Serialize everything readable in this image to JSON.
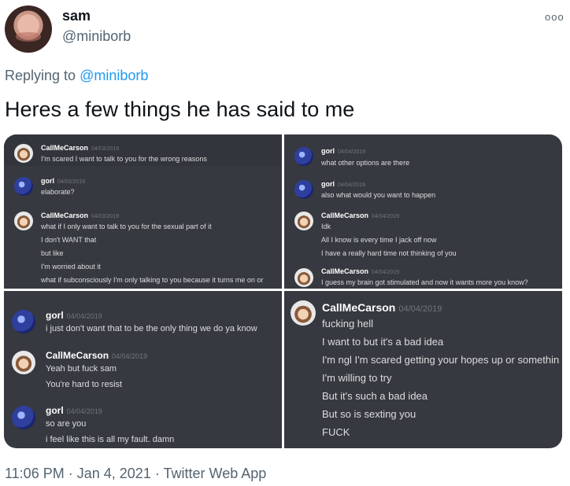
{
  "tweet": {
    "name": "sam",
    "handle": "@miniborb",
    "more_icon": "ooo",
    "replying_label": "Replying to",
    "replying_to": "@miniborb",
    "text": "Heres a few things he has said to me",
    "time": "11:06 PM",
    "sep1": "·",
    "date": "Jan 4, 2021",
    "sep2": "·",
    "source": "Twitter Web App"
  },
  "screenshots": {
    "p1": {
      "m1": {
        "author": "CallMeCarson",
        "time": "04/03/2019",
        "lines": [
          "I'm scared I want to talk to you for the wrong reasons"
        ]
      },
      "m2": {
        "author": "gorl",
        "time": "04/03/2019",
        "lines": [
          "elaborate?"
        ]
      },
      "m3": {
        "author": "CallMeCarson",
        "time": "04/03/2019",
        "lines": [
          "what if I only want to talk to you for the sexual part of it",
          "I don't WANT that",
          "but like",
          "I'm worried about it",
          "what if subconsciously I'm only talking to you because it turns me on or"
        ]
      }
    },
    "p2": {
      "m1": {
        "author": "gorl",
        "time": "04/04/2019",
        "lines": [
          "what other options are there"
        ]
      },
      "m2": {
        "author": "gorl",
        "time": "04/04/2019",
        "lines": [
          "also what would you want to happen"
        ]
      },
      "m3": {
        "author": "CallMeCarson",
        "time": "04/04/2019",
        "lines": [
          "Idk",
          "All I know is every time I jack off now",
          "I have a really hard time not thinking of you"
        ]
      },
      "m4": {
        "author": "CallMeCarson",
        "time": "04/04/2019",
        "lines": [
          "I guess my brain got stimulated and now it wants more you know?"
        ]
      }
    },
    "p3": {
      "m1": {
        "author": "gorl",
        "time": "04/04/2019",
        "lines": [
          "i just don't want that to be the only thing we do ya know"
        ]
      },
      "m2": {
        "author": "CallMeCarson",
        "time": "04/04/2019",
        "lines": [
          "Yeah but fuck sam",
          "You're hard to resist"
        ]
      },
      "m3": {
        "author": "gorl",
        "time": "04/04/2019",
        "lines": [
          "so are you",
          "i feel like this is all my fault. damn"
        ]
      }
    },
    "p4": {
      "m1": {
        "author": "CallMeCarson",
        "time": "04/04/2019",
        "lines": [
          "fucking hell",
          "I want to but it's a bad idea",
          "I'm ngl I'm scared getting your hopes up or somethin",
          "I'm willing to try",
          "But it's such a bad idea",
          "But so is sexting you",
          "FUCK"
        ]
      }
    }
  },
  "colors": {
    "discord_bg": "#36393f",
    "link": "#1d9bf0",
    "muted": "#536471"
  }
}
